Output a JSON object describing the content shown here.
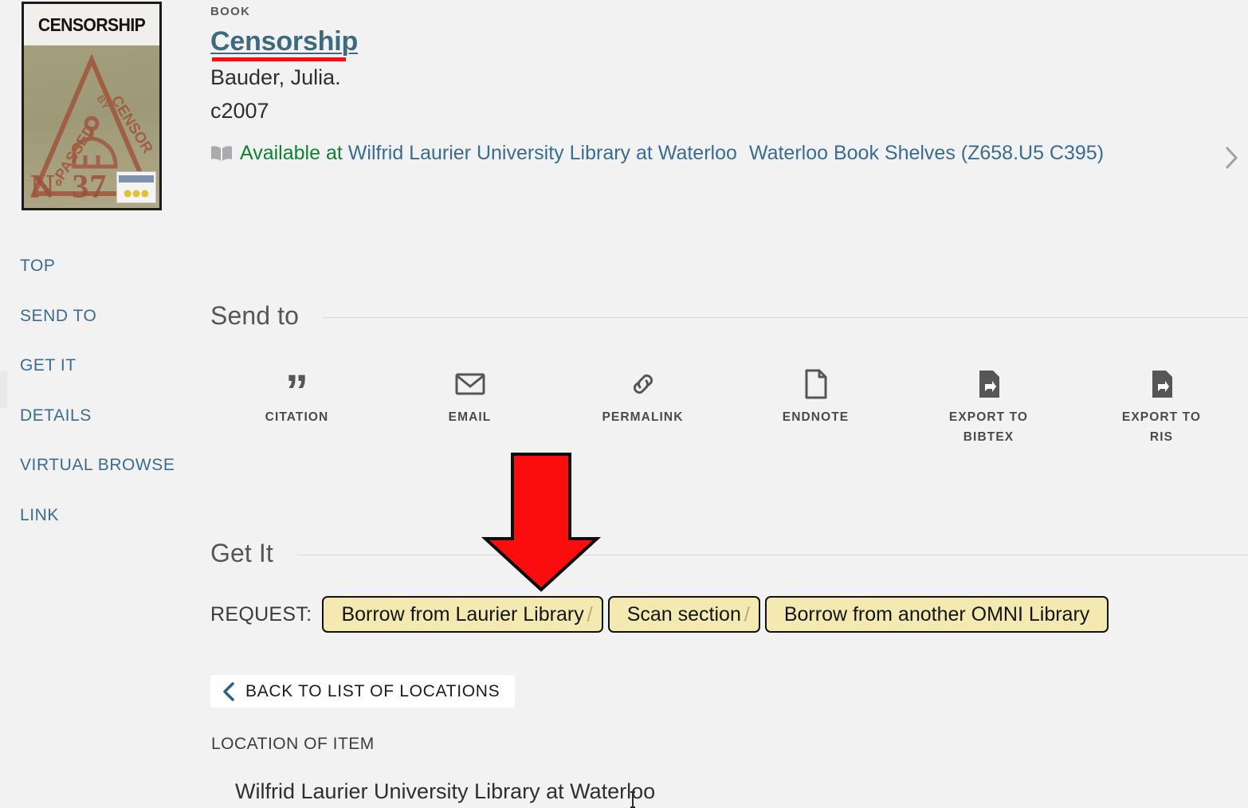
{
  "record": {
    "type_label": "BOOK",
    "title": "Censorship",
    "author": "Bauder, Julia.",
    "date": "c2007",
    "availability": {
      "status": "Available at",
      "location": "Wilfrid Laurier University Library at Waterloo",
      "sublocation": "Waterloo Book Shelves (Z658.U5 C395)",
      "status_color": "#108330",
      "link_color": "#3a6c93"
    },
    "cover": {
      "title_text": "CENSORSHIP",
      "stamp_text_1": "PASSED",
      "stamp_text_2": "BY",
      "stamp_text_3": "CENSOR",
      "number": "37"
    }
  },
  "sidebar": {
    "items": [
      {
        "label": "TOP"
      },
      {
        "label": "SEND TO"
      },
      {
        "label": "GET IT"
      },
      {
        "label": "DETAILS"
      },
      {
        "label": "VIRTUAL BROWSE"
      },
      {
        "label": "LINK"
      }
    ]
  },
  "send_to": {
    "heading": "Send to",
    "actions": [
      {
        "label": "CITATION",
        "icon": "quote-icon"
      },
      {
        "label": "EMAIL",
        "icon": "envelope-icon"
      },
      {
        "label": "PERMALINK",
        "icon": "link-icon"
      },
      {
        "label": "ENDNOTE",
        "icon": "document-icon"
      },
      {
        "label": "EXPORT TO BIBTEX",
        "icon": "document-export-icon"
      },
      {
        "label": "EXPORT TO RIS",
        "icon": "document-export-icon"
      }
    ]
  },
  "get_it": {
    "heading": "Get It",
    "request_label": "REQUEST:",
    "request_options": [
      {
        "label": "Borrow from Laurier Library",
        "separator": "/"
      },
      {
        "label": "Scan section",
        "separator": "/"
      },
      {
        "label": "Borrow from another OMNI Library",
        "separator": ""
      }
    ],
    "button_fill": "#f4eab1",
    "back_button_label": "BACK TO LIST OF LOCATIONS",
    "location_heading": "LOCATION OF ITEM",
    "location_value": "Wilfrid Laurier University Library at Waterloo"
  },
  "annotation": {
    "arrow_color": "#fc0d0d",
    "title_underline_color": "#fc0d0d"
  }
}
